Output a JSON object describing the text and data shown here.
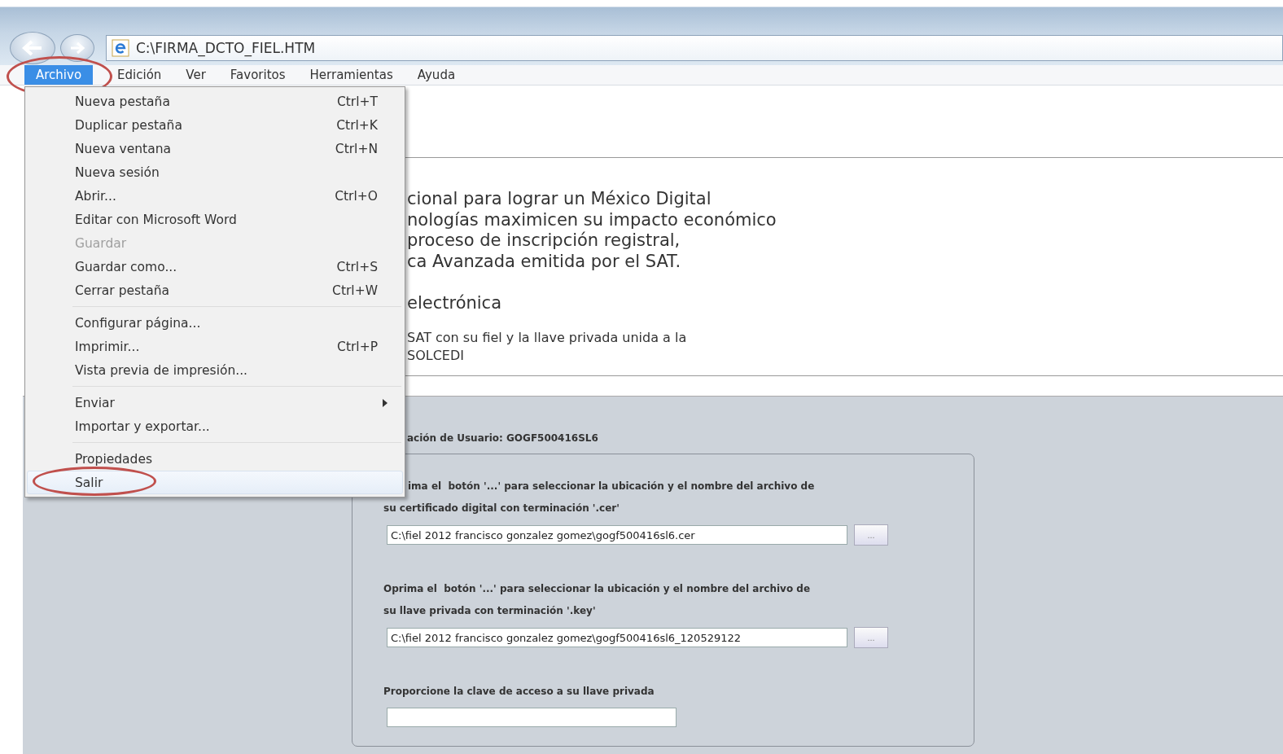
{
  "address_bar": {
    "url": "C:\\FIRMA_DCTO_FIEL.HTM"
  },
  "menu_bar": [
    {
      "label": "Archivo",
      "selected": true,
      "circled": true
    },
    {
      "label": "Edición",
      "selected": false,
      "circled": false
    },
    {
      "label": "Ver",
      "selected": false,
      "circled": false
    },
    {
      "label": "Favoritos",
      "selected": false,
      "circled": false
    },
    {
      "label": "Herramientas",
      "selected": false,
      "circled": false
    },
    {
      "label": "Ayuda",
      "selected": false,
      "circled": false
    }
  ],
  "file_menu": [
    {
      "kind": "item",
      "label": "Nueva pestaña",
      "shortcut": "Ctrl+T",
      "disabled": false,
      "selected": false,
      "submenu": false,
      "circled": false
    },
    {
      "kind": "item",
      "label": "Duplicar pestaña",
      "shortcut": "Ctrl+K",
      "disabled": false,
      "selected": false,
      "submenu": false,
      "circled": false
    },
    {
      "kind": "item",
      "label": "Nueva ventana",
      "shortcut": "Ctrl+N",
      "disabled": false,
      "selected": false,
      "submenu": false,
      "circled": false
    },
    {
      "kind": "item",
      "label": "Nueva sesión",
      "disabled": false,
      "selected": false,
      "submenu": false,
      "circled": false
    },
    {
      "kind": "item",
      "label": "Abrir...",
      "shortcut": "Ctrl+O",
      "disabled": false,
      "selected": false,
      "submenu": false,
      "circled": false
    },
    {
      "kind": "item",
      "label": "Editar con Microsoft Word",
      "disabled": false,
      "selected": false,
      "submenu": false,
      "circled": false
    },
    {
      "kind": "item",
      "label": "Guardar",
      "disabled": true,
      "selected": false,
      "submenu": false,
      "circled": false
    },
    {
      "kind": "item",
      "label": "Guardar como...",
      "shortcut": "Ctrl+S",
      "disabled": false,
      "selected": false,
      "submenu": false,
      "circled": false
    },
    {
      "kind": "item",
      "label": "Cerrar pestaña",
      "shortcut": "Ctrl+W",
      "disabled": false,
      "selected": false,
      "submenu": false,
      "circled": false
    },
    {
      "kind": "separator"
    },
    {
      "kind": "item",
      "label": "Configurar página...",
      "disabled": false,
      "selected": false,
      "submenu": false,
      "circled": false
    },
    {
      "kind": "item",
      "label": "Imprimir...",
      "shortcut": "Ctrl+P",
      "disabled": false,
      "selected": false,
      "submenu": false,
      "circled": false
    },
    {
      "kind": "item",
      "label": "Vista previa de impresión...",
      "disabled": false,
      "selected": false,
      "submenu": false,
      "circled": false
    },
    {
      "kind": "separator"
    },
    {
      "kind": "item",
      "label": "Enviar",
      "disabled": false,
      "selected": false,
      "submenu": true,
      "circled": false
    },
    {
      "kind": "item",
      "label": "Importar y exportar...",
      "disabled": false,
      "selected": false,
      "submenu": false,
      "circled": false
    },
    {
      "kind": "separator"
    },
    {
      "kind": "item",
      "label": "Propiedades",
      "disabled": false,
      "selected": false,
      "submenu": false,
      "circled": false
    },
    {
      "kind": "item",
      "label": "Salir",
      "disabled": false,
      "selected": true,
      "submenu": false,
      "circled": true
    }
  ],
  "page": {
    "intro_lines": [
      "cional para lograr un México Digital",
      "nologías maximicen su impacto económico",
      "proceso de inscripción registral,",
      "ca Avanzada emitida por el SAT."
    ],
    "heading": "electrónica",
    "note_lines": [
      "SAT con su fiel y la llave privada unida a la",
      "SOLCEDI"
    ]
  },
  "form": {
    "user_label": "ación de Usuario: GOGF500416SL6",
    "fields": [
      {
        "kind": "file",
        "label_lines": [
          "ima el  botón '...' para seleccionar la ubicación y el nombre del archivo de",
          "su certificado digital con terminación '.cer'"
        ],
        "value": "C:\\fiel 2012 francisco gonzalez gomez\\gogf500416sl6.cer",
        "button": "..."
      },
      {
        "kind": "file",
        "label_lines": [
          "Oprima el  botón '...' para seleccionar la ubicación y el nombre del archivo de",
          "su llave privada con terminación '.key'"
        ],
        "value": "C:\\fiel 2012 francisco gonzalez gomez\\gogf500416sl6_120529122",
        "button": "..."
      },
      {
        "kind": "password",
        "label_lines": [
          "Proporcione la clave de acceso a su llave privada"
        ]
      }
    ]
  }
}
